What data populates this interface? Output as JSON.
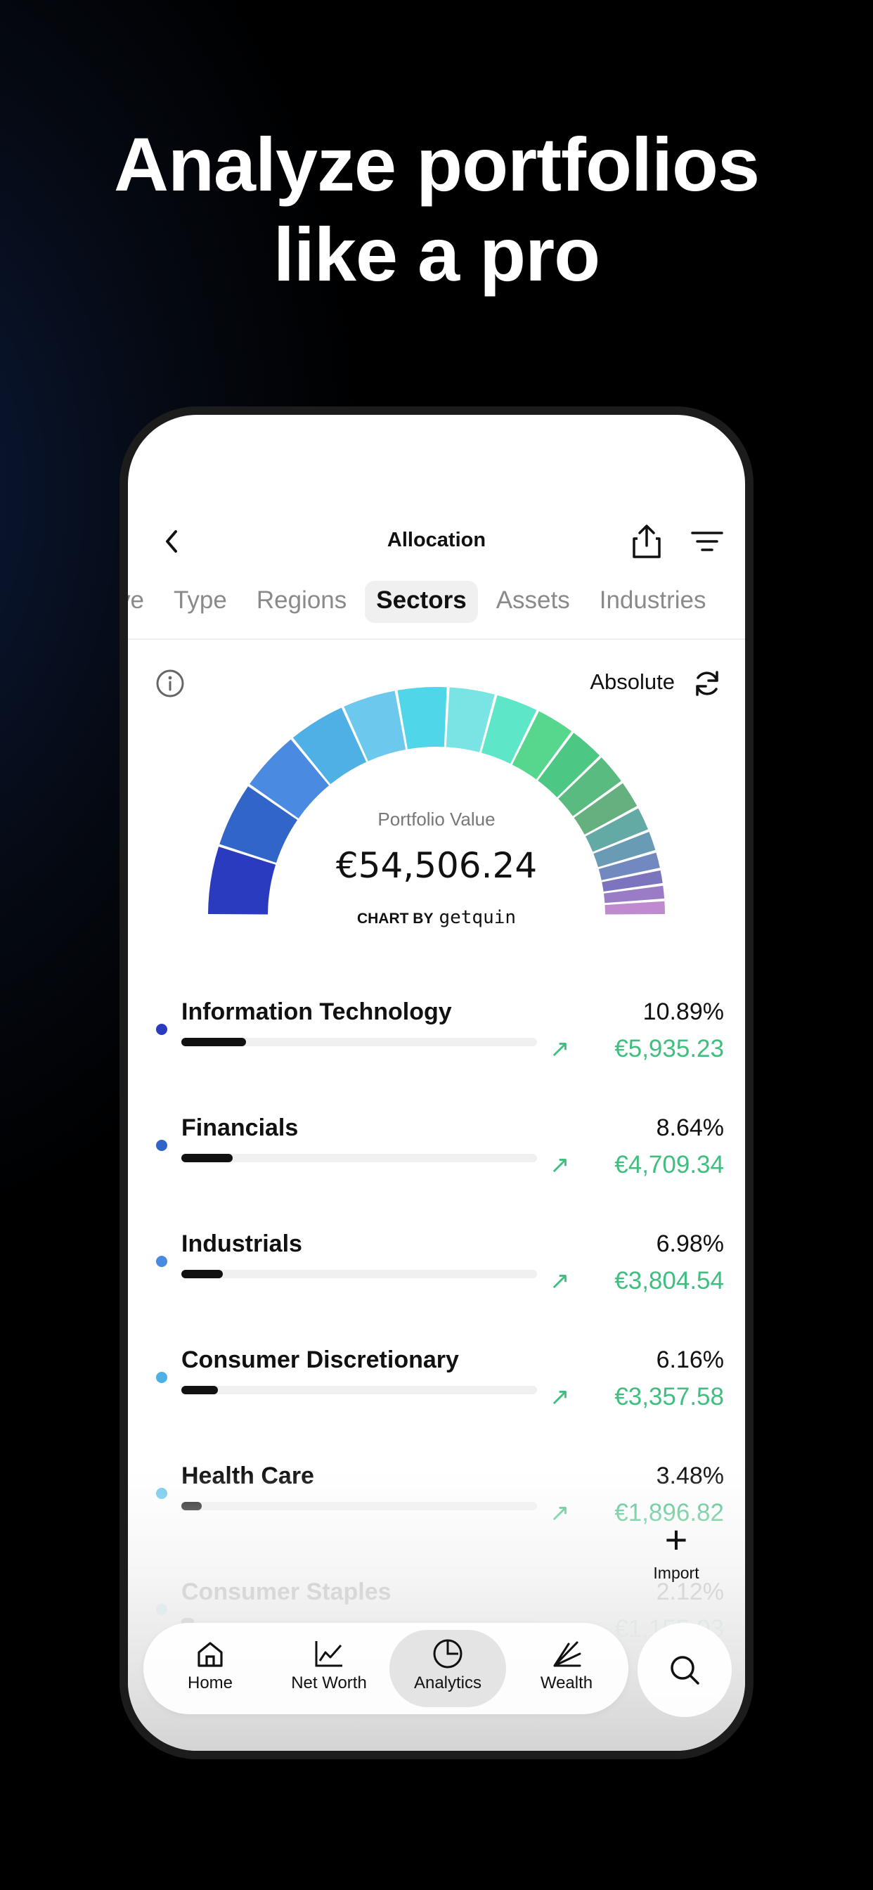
{
  "headline": {
    "line1": "Analyze portfolios",
    "line2": "like a pro"
  },
  "header": {
    "title": "Allocation"
  },
  "tabs": [
    {
      "label": "ve",
      "active": false
    },
    {
      "label": "Type",
      "active": false
    },
    {
      "label": "Regions",
      "active": false
    },
    {
      "label": "Sectors",
      "active": true
    },
    {
      "label": "Assets",
      "active": false
    },
    {
      "label": "Industries",
      "active": false
    }
  ],
  "controls": {
    "mode_label": "Absolute"
  },
  "gauge": {
    "label": "Portfolio Value",
    "value": "€54,506.24",
    "chart_by": "CHART BY",
    "brand": "getquin"
  },
  "sectors": [
    {
      "name": "Information Technology",
      "percent": "10.89%",
      "amount": "€5,935.23",
      "share": 0.1089,
      "color": "#2a3bbf"
    },
    {
      "name": "Financials",
      "percent": "8.64%",
      "amount": "€4,709.34",
      "share": 0.0864,
      "color": "#3166c8"
    },
    {
      "name": "Industrials",
      "percent": "6.98%",
      "amount": "€3,804.54",
      "share": 0.0698,
      "color": "#4a8ae0"
    },
    {
      "name": "Consumer Discretionary",
      "percent": "6.16%",
      "amount": "€3,357.58",
      "share": 0.0616,
      "color": "#4fb0e6"
    },
    {
      "name": "Health Care",
      "percent": "3.48%",
      "amount": "€1,896.82",
      "share": 0.0348,
      "color": "#6cc8ec"
    },
    {
      "name": "Consumer Staples",
      "percent": "2.12%",
      "amount": "€1,155.03",
      "share": 0.0212,
      "color": "#4fd6e8"
    }
  ],
  "import": {
    "label": "Import"
  },
  "nav": [
    {
      "label": "Home",
      "icon": "home-icon",
      "active": false
    },
    {
      "label": "Net Worth",
      "icon": "line-chart-icon",
      "active": false
    },
    {
      "label": "Analytics",
      "icon": "pie-chart-icon",
      "active": true
    },
    {
      "label": "Wealth",
      "icon": "wealth-fan-icon",
      "active": false
    }
  ],
  "colors": {
    "accent_green": "#3fbf7f",
    "gauge_palette": [
      "#2a3bbf",
      "#3166c8",
      "#4a8ae0",
      "#4fb0e6",
      "#6cc8ec",
      "#4fd6e8",
      "#7ae4e4",
      "#5ee6c8",
      "#57d68e",
      "#4cc784",
      "#5abb80",
      "#66b080",
      "#63a9a4",
      "#6a9bb4",
      "#7289c0",
      "#7c74bf",
      "#9a7cc6",
      "#c08ad0"
    ]
  }
}
